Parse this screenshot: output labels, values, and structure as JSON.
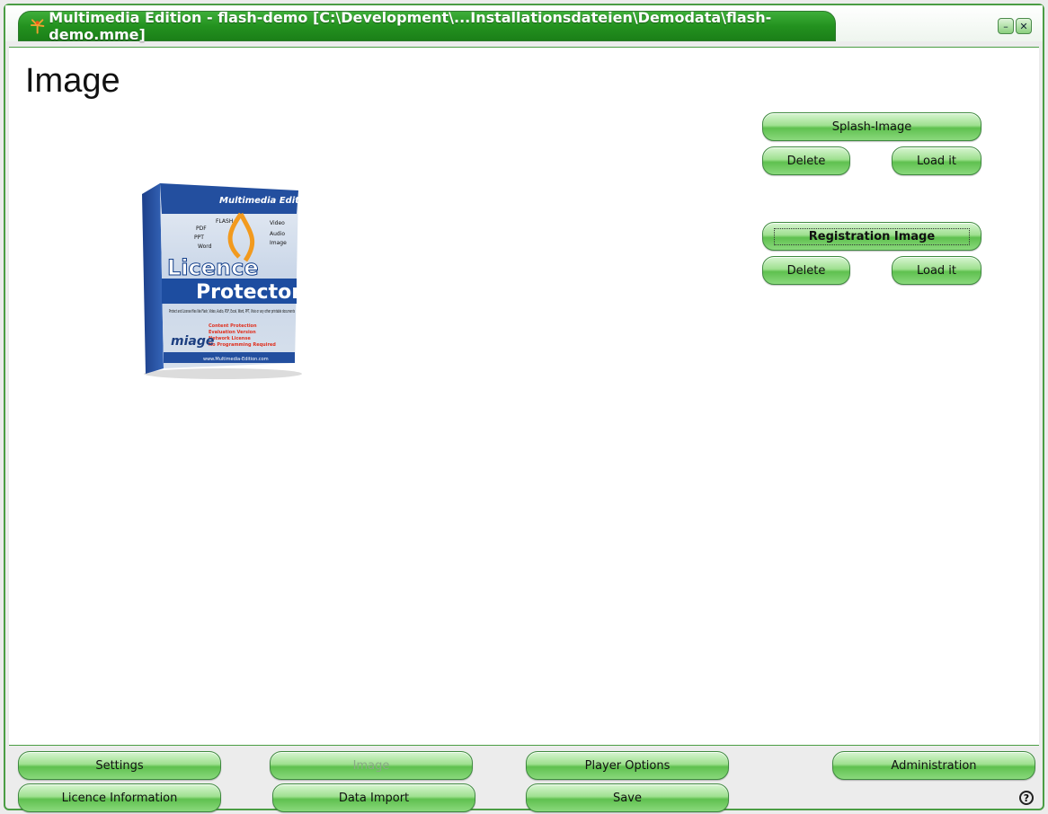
{
  "window": {
    "title": "Multimedia Edition - flash-demo [C:\\Development\\...Installationsdateien\\Demodata\\flash-demo.mme]",
    "minimize_glyph": "–",
    "close_glyph": "✕"
  },
  "page": {
    "title": "Image"
  },
  "splash": {
    "header_label": "Splash-Image",
    "delete_label": "Delete",
    "load_label": "Load it"
  },
  "registration": {
    "header_label": "Registration Image",
    "delete_label": "Delete",
    "load_label": "Load it"
  },
  "product_box": {
    "ribbon": "Multimedia Edition",
    "formats": [
      "FLASH",
      "Video",
      "PDF",
      "Audio",
      "PPT",
      "Image",
      "Word"
    ],
    "title_line1": "Licence",
    "title_line2": "Protector",
    "description": "Protect and License files like Flash, Video, Audio, PDF, Excel, Word, PPT, Visio or any other printable documents",
    "features": [
      "Content Protection",
      "Evaluation Version",
      "Network License",
      "No Programming Required"
    ],
    "brand": "miage",
    "website": "www.Multimedia-Edition.com"
  },
  "nav": {
    "settings": "Settings",
    "image": "Image",
    "player_options": "Player Options",
    "administration": "Administration",
    "licence_information": "Licence Information",
    "data_import": "Data Import",
    "save": "Save"
  },
  "help_glyph": "?",
  "colors": {
    "frame_green": "#4b9d44",
    "title_green": "#23921f",
    "button_green": "#9fe090"
  }
}
